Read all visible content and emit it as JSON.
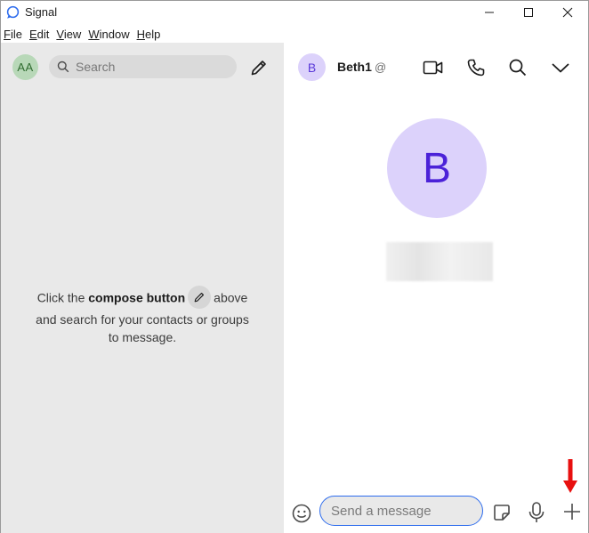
{
  "window": {
    "title": "Signal",
    "controls": [
      "minimize",
      "maximize",
      "close"
    ]
  },
  "menubar": [
    {
      "label": "File",
      "mnemonic": "F",
      "rest": "ile"
    },
    {
      "label": "Edit",
      "mnemonic": "E",
      "rest": "dit"
    },
    {
      "label": "View",
      "mnemonic": "V",
      "rest": "iew"
    },
    {
      "label": "Window",
      "mnemonic": "W",
      "rest": "indow"
    },
    {
      "label": "Help",
      "mnemonic": "H",
      "rest": "elp"
    }
  ],
  "sidebar": {
    "profile_initials": "AA",
    "search_placeholder": "Search",
    "empty_state": {
      "before": "Click the",
      "bold": "compose button",
      "after_icon": "above",
      "line2": "and search for your contacts or groups",
      "line3": "to message."
    }
  },
  "conversation": {
    "header": {
      "avatar_initial": "B",
      "name": "Beth1",
      "name_suffix": "@",
      "icons": [
        "video-call-icon",
        "voice-call-icon",
        "search-icon",
        "chevron-down-icon"
      ]
    },
    "hero": {
      "avatar_initial": "B"
    },
    "composer": {
      "placeholder": "Send a message",
      "icons": [
        "emoji-icon",
        "sticker-icon",
        "microphone-icon",
        "plus-icon"
      ]
    }
  },
  "colors": {
    "accent": "#2c6bed",
    "avatar_purple_bg": "#dcd2fb",
    "avatar_purple_fg": "#4b22d8",
    "avatar_green_bg": "#b8d8b8",
    "annotation_red": "#e8100f"
  }
}
